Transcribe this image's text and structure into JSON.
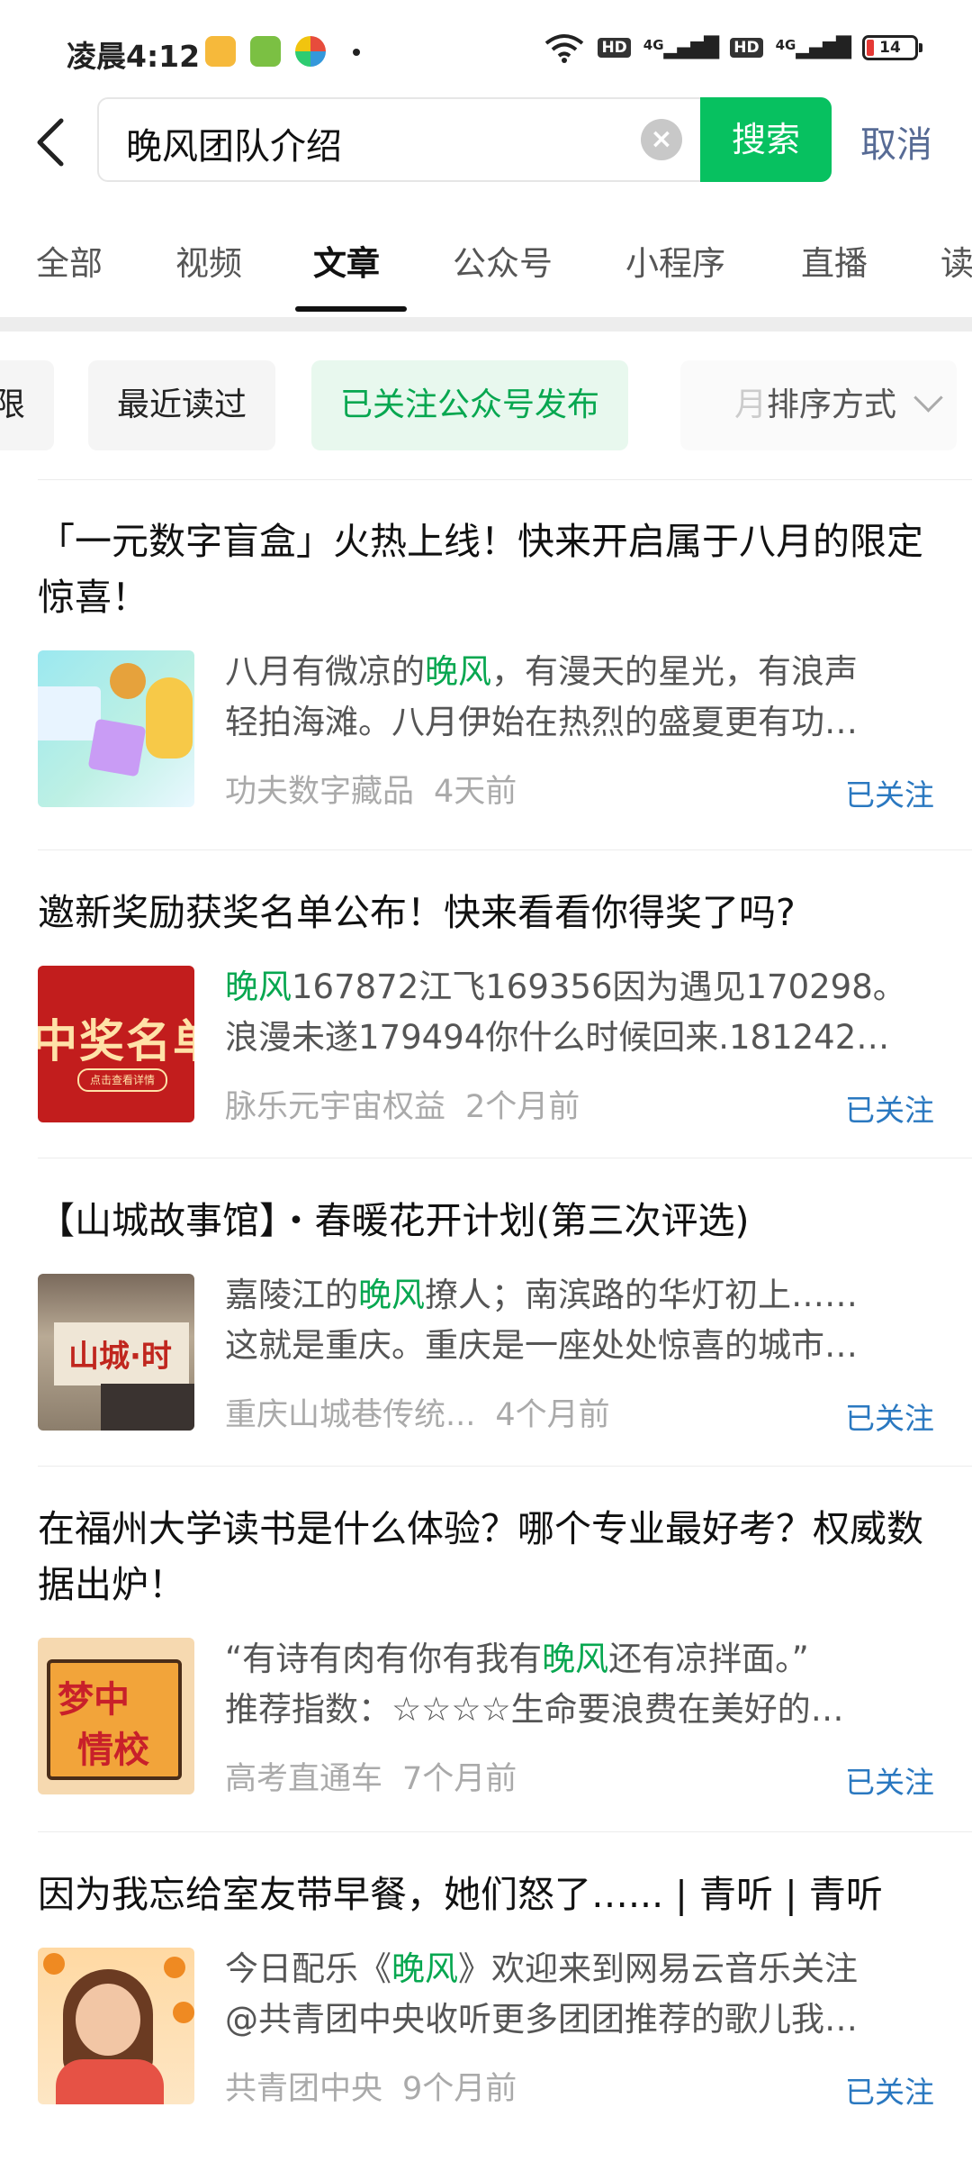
{
  "status_bar": {
    "time": "凌晨4:12",
    "network_1": "4G",
    "network_2": "4G",
    "hd_1": "HD",
    "hd_2": "HD",
    "battery": "14"
  },
  "header": {
    "query": "晚风团队介绍",
    "search_label": "搜索",
    "cancel_label": "取消"
  },
  "tabs": [
    {
      "label": "全部"
    },
    {
      "label": "视频"
    },
    {
      "label": "文章"
    },
    {
      "label": "公众号"
    },
    {
      "label": "小程序"
    },
    {
      "label": "直播"
    },
    {
      "label": "读"
    }
  ],
  "active_tab": "文章",
  "filters": {
    "chips": [
      {
        "label": "限"
      },
      {
        "label": "最近读过"
      },
      {
        "label": "已关注公众号发布"
      }
    ],
    "sort_hint": "月",
    "sort_label": "排序方式"
  },
  "articles": [
    {
      "title": "「一元数字盲盒」火热上线！快来开启属于八月的限定惊喜！",
      "snippet_line1_pre": "八月有微凉的",
      "snippet_line1_hl": "晚风",
      "snippet_line1_post": "，有漫天的星光，有浪声",
      "snippet_line2": "轻拍海滩。八月伊始在热烈的盛夏更有功…",
      "source": "功夫数字藏品",
      "ago": "4天前",
      "status": "已关注"
    },
    {
      "title": "邀新奖励获奖名单公布！快来看看你得奖了吗?",
      "snippet_line1_pre": "",
      "snippet_line1_hl": "晚风",
      "snippet_line1_post": "167872江飞169356因为遇见170298。",
      "snippet_line2": "浪漫未遂179494你什么时候回来.181242…",
      "thumb_text": "中奖名单",
      "thumb_sub": "点击查看详情",
      "source": "脉乐元宇宙权益",
      "ago": "2个月前",
      "status": "已关注"
    },
    {
      "title": "【山城故事馆】・春暖花开计划(第三次评选)",
      "snippet_line1_pre": "嘉陵江的",
      "snippet_line1_hl": "晚风",
      "snippet_line1_post": "撩人；南滨路的华灯初上……",
      "snippet_line2": "这就是重庆。重庆是一座处处惊喜的城市…",
      "thumb_text": "山城·时",
      "source": "重庆山城巷传统...",
      "ago": "4个月前",
      "status": "已关注"
    },
    {
      "title": "在福州大学读书是什么体验？哪个专业最好考？权威数据出炉！",
      "snippet_line1_pre": "“有诗有肉有你有我有",
      "snippet_line1_hl": "晚风",
      "snippet_line1_post": "还有凉拌面。”",
      "snippet_line2": "推荐指数：☆☆☆☆生命要浪费在美好的…",
      "thumb_text_1": "梦中",
      "thumb_text_2": "情校",
      "source": "高考直通车",
      "ago": "7个月前",
      "status": "已关注"
    },
    {
      "title": "因为我忘给室友带早餐，她们怒了…... | 青听 | 青听",
      "snippet_line1_pre": "今日配乐《",
      "snippet_line1_hl": "晚风",
      "snippet_line1_post": "》欢迎来到网易云音乐关注",
      "snippet_line2": "@共青团中央收听更多团团推荐的歌儿我…",
      "source": "共青团中央",
      "ago": "9个月前",
      "status": "已关注"
    }
  ]
}
